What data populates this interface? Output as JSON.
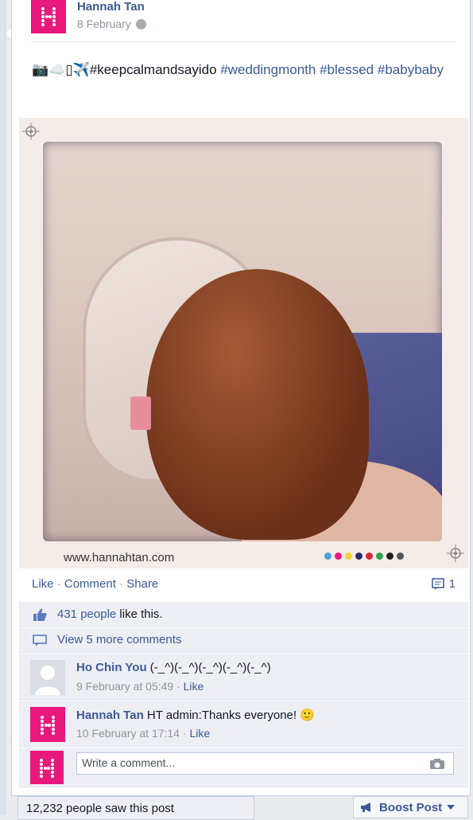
{
  "post": {
    "author": "Hannah Tan",
    "date": "8 February",
    "text_prefix": "📷☁️▯✈️#keepcalmandsayido",
    "tags": [
      "#weddingmonth",
      "#blessed",
      "#babybaby"
    ],
    "photo_watermark": "www.hannahtan.com"
  },
  "actions": {
    "like": "Like",
    "comment": "Comment",
    "share": "Share",
    "comment_count": "1"
  },
  "likes": {
    "count_label": "431 people",
    "suffix": " like this."
  },
  "view_more": "View 5 more comments",
  "comments": [
    {
      "author": "Ho Chin You",
      "text": "(-_^)(-_^)(-_^)(-_^)(-_^)",
      "time": "9 February at 05:49",
      "like": "Like"
    },
    {
      "author": "Hannah Tan",
      "text": "HT admin:Thanks everyone! 🙂",
      "time": "10 February at 17:14",
      "like": "Like"
    }
  ],
  "write_comment_placeholder": "Write a comment...",
  "footer": {
    "seen": "12,232 people saw this post",
    "boost": "Boost Post"
  },
  "colors": {
    "link": "#3b5998",
    "brand_pink": "#e8187d"
  }
}
